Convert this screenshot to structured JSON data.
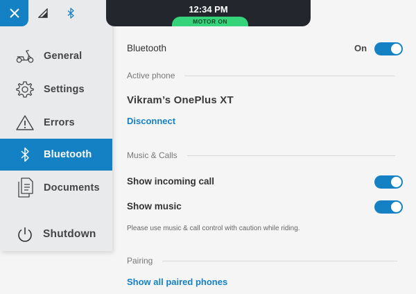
{
  "status": {
    "time": "12:34 PM",
    "motor": "MOTOR ON"
  },
  "sidebar": {
    "close_icon": "close-icon",
    "signal_icon": "signal-icon",
    "bluetooth_icon": "bluetooth-icon",
    "items": [
      {
        "label": "General",
        "icon": "scooter-icon"
      },
      {
        "label": "Settings",
        "icon": "gear-icon"
      },
      {
        "label": "Errors",
        "icon": "warning-icon"
      },
      {
        "label": "Bluetooth",
        "icon": "bluetooth-icon",
        "active": true
      },
      {
        "label": "Documents",
        "icon": "documents-icon"
      }
    ],
    "shutdown": {
      "label": "Shutdown",
      "icon": "power-icon"
    }
  },
  "bluetooth": {
    "label": "Bluetooth",
    "state": "On",
    "enabled": true
  },
  "active_phone": {
    "section": "Active phone",
    "name": "Vikram’s OnePlus XT",
    "disconnect": "Disconnect"
  },
  "music_calls": {
    "section": "Music & Calls",
    "incoming_call": {
      "label": "Show incoming call",
      "enabled": true
    },
    "music": {
      "label": "Show music",
      "enabled": true
    },
    "note": "Please use music & call control with caution while riding."
  },
  "pairing": {
    "section": "Pairing",
    "show_all": "Show all paired phones"
  },
  "colors": {
    "accent": "#1581c5",
    "motor_on": "#35d47a",
    "sidebar_bg": "#e9eaec",
    "page_bg": "#f5f5f5"
  }
}
